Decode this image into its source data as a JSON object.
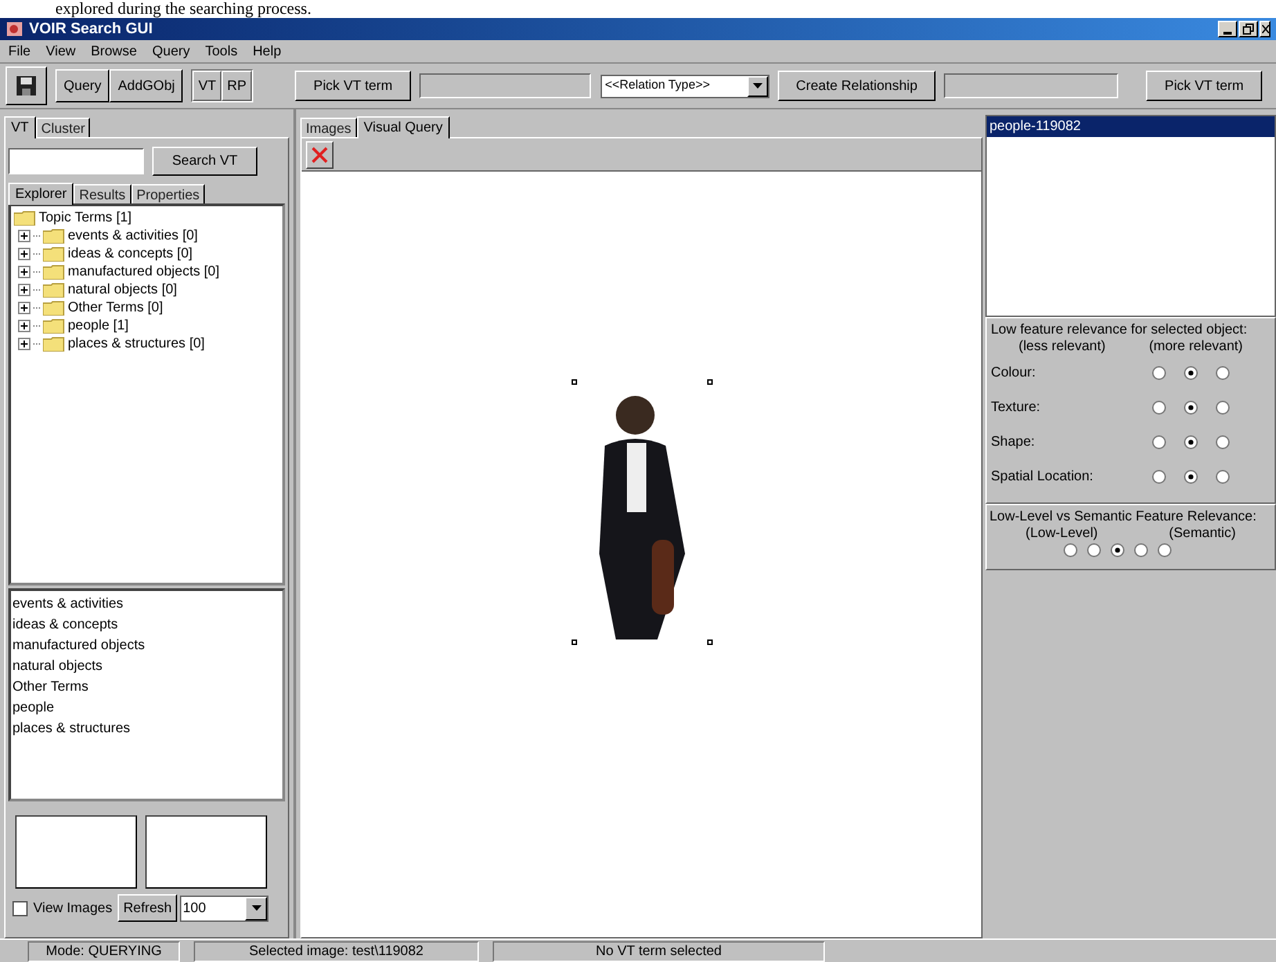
{
  "caption": "explored during the searching process.",
  "window": {
    "title": "VOIR Search GUI"
  },
  "menu": [
    "File",
    "View",
    "Browse",
    "Query",
    "Tools",
    "Help"
  ],
  "toolbar": {
    "buttons": [
      "Query",
      "AddGObj"
    ],
    "toggles": [
      "VT",
      "RP"
    ],
    "pick_left": "Pick VT term",
    "relation_type": "<<Relation Type>>",
    "create": "Create Relationship",
    "pick_right": "Pick VT term"
  },
  "left_tabs": [
    {
      "label": "VT",
      "selected": true
    },
    {
      "label": "Cluster",
      "selected": false
    }
  ],
  "search_button": "Search VT",
  "sub_tabs": [
    {
      "label": "Explorer",
      "selected": true
    },
    {
      "label": "Results",
      "selected": false
    },
    {
      "label": "Properties",
      "selected": false
    }
  ],
  "tree": {
    "label": "Topic Terms [1]",
    "children": [
      {
        "label": "events & activities [0]",
        "expanded": false
      },
      {
        "label": "ideas & concepts [0]",
        "expanded": false
      },
      {
        "label": "manufactured objects [0]",
        "expanded": false
      },
      {
        "label": "natural objects [0]",
        "expanded": false
      },
      {
        "label": "Other Terms [0]",
        "expanded": false
      },
      {
        "label": "people [1]",
        "expanded": false
      },
      {
        "label": "places & structures [0]",
        "expanded": false
      }
    ]
  },
  "term_list": [
    "events & activities",
    "ideas & concepts",
    "manufactured objects",
    "natural objects",
    "Other Terms",
    "people",
    "places & structures"
  ],
  "view_images": {
    "label": "View Images",
    "checked": false
  },
  "refresh": "Refresh",
  "count": "100",
  "center_tabs": [
    {
      "label": "Images",
      "selected": false
    },
    {
      "label": "Visual Query",
      "selected": true
    }
  ],
  "objects": [
    {
      "label": "people-119082",
      "selected": true
    }
  ],
  "feature_panel": {
    "title": "Low feature relevance for selected object:",
    "low": "(less relevant)",
    "high": "(more relevant)",
    "rows": [
      {
        "label": "Colour:",
        "radios": [
          {
            "selected": false
          },
          {
            "selected": true
          },
          {
            "selected": false
          }
        ]
      },
      {
        "label": "Texture:",
        "radios": [
          {
            "selected": false
          },
          {
            "selected": true
          },
          {
            "selected": false
          }
        ]
      },
      {
        "label": "Shape:",
        "radios": [
          {
            "selected": false
          },
          {
            "selected": true
          },
          {
            "selected": false
          }
        ]
      },
      {
        "label": "Spatial Location:",
        "radios": [
          {
            "selected": false
          },
          {
            "selected": true
          },
          {
            "selected": false
          }
        ]
      }
    ]
  },
  "semantic_panel": {
    "title": "Low-Level vs Semantic Feature Relevance:",
    "low": "(Low-Level)",
    "high": "(Semantic)",
    "radios": [
      {
        "selected": false
      },
      {
        "selected": false
      },
      {
        "selected": true
      },
      {
        "selected": false
      },
      {
        "selected": false
      }
    ]
  },
  "status_bar": [
    "Mode: QUERYING",
    "Selected image: test\\119082",
    "No VT term selected"
  ]
}
